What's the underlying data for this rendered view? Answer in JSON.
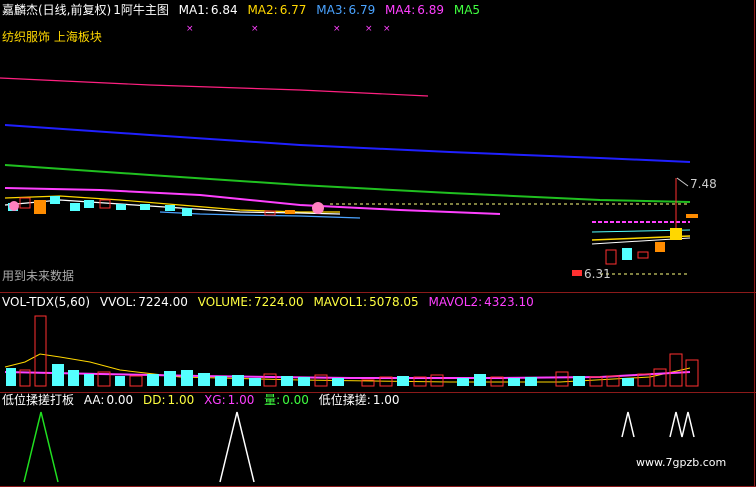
{
  "main": {
    "title": "嘉麟杰(日线,前复权)",
    "indicator_name": "1阿牛主图",
    "ma": [
      {
        "label": "MA1:",
        "value": "6.84",
        "color": "#ffffff"
      },
      {
        "label": "MA2:",
        "value": "6.77",
        "color": "#ffd700"
      },
      {
        "label": "MA3:",
        "value": "6.79",
        "color": "#4aa3ff"
      },
      {
        "label": "MA4:",
        "value": "6.89",
        "color": "#ff40ff"
      },
      {
        "label": "MA5",
        "value": "",
        "color": "#40ff40"
      }
    ],
    "sector": "纺织服饰 上海板块",
    "future_note": "用到未来数据",
    "price_high": "7.48",
    "price_low": "6.31"
  },
  "volume": {
    "name": "VOL-TDX(5,60)",
    "vvol_label": "VVOL:",
    "vvol_value": "7224.00",
    "volume_label": "VOLUME:",
    "volume_value": "7224.00",
    "mavol1_label": "MAVOL1:",
    "mavol1_value": "5078.05",
    "mavol2_label": "MAVOL2:",
    "mavol2_value": "4323.10"
  },
  "indicator": {
    "name": "低位揉搓打板",
    "aa_label": "AA:",
    "aa_value": "0.00",
    "dd_label": "DD:",
    "dd_value": "1.00",
    "xg_label": "XG:",
    "xg_value": "1.00",
    "liang_label": "量:",
    "liang_value": "0.00",
    "rc_label": "低位揉搓:",
    "rc_value": "1.00"
  },
  "watermark": "www.7gpzb.com",
  "colors": {
    "up": "#ff3030",
    "down": "#54ffff",
    "grid": "#8b1a1a",
    "ma1": "#ffffff",
    "ma2": "#ffd700",
    "ma3": "#4aa3ff",
    "ma4": "#ff40ff",
    "ma5": "#40ff40",
    "ma_long": "#2020ff"
  }
}
